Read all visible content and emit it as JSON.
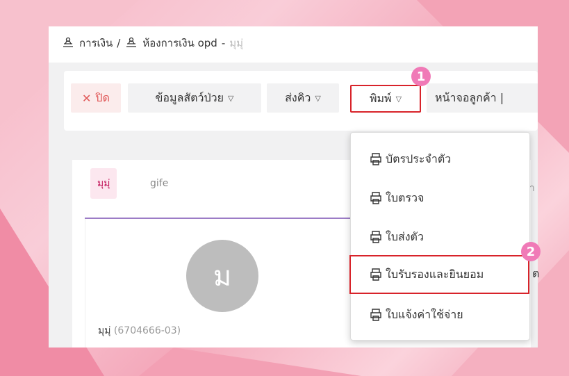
{
  "breadcrumb": {
    "item1": "การเงิน",
    "separator": "/",
    "item2": "ห้องการเงิน opd",
    "dash": "-",
    "item3": "มุมุ่"
  },
  "toolbar": {
    "close_label": "ปิด",
    "pet_info_label": "ข้อมูลสัตว์ป่วย",
    "send_queue_label": "ส่งคิว",
    "print_label": "พิมพ์",
    "customer_screen_label": "หน้าจอลูกค้า |"
  },
  "tabs": [
    "มุมุ่",
    "gife"
  ],
  "right_peek": "ว่า",
  "profile": {
    "avatar_letter": "ม",
    "pet_name": "มุมุ่",
    "pet_code": "(6704666-03)"
  },
  "print_menu": {
    "items": [
      "บัตรประจำตัว",
      "ใบตรวจ",
      "ใบส่งตัว",
      "ใบรับรองและยินยอม",
      "ใบแจ้งค่าใช้จ่าย"
    ]
  },
  "badges": {
    "step1": "1",
    "step2": "2"
  },
  "colors": {
    "highlight": "#d8232a",
    "badge": "#f07ab7",
    "close": "#e05555",
    "tab_active": "#c2185b"
  },
  "icons": {
    "breadcrumb": "cashier-icon",
    "menu": "printer-icon",
    "close": "x-icon"
  }
}
